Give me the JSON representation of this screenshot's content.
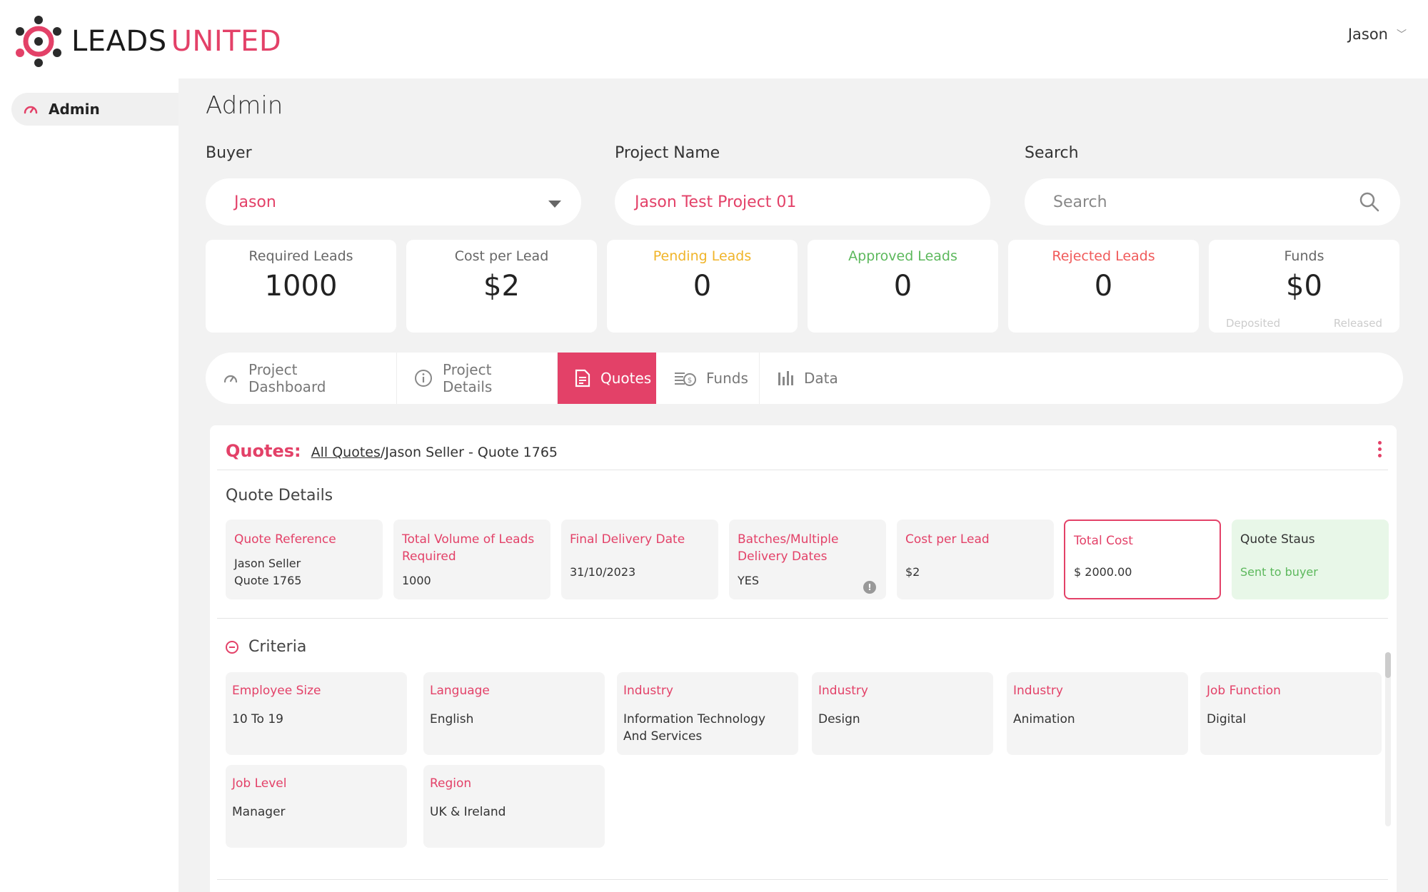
{
  "header": {
    "logo_part1": "LEADS",
    "logo_part2": "UNITED",
    "user_name": "Jason"
  },
  "sidebar": {
    "items": [
      {
        "label": "Admin",
        "icon": "gauge-icon"
      }
    ]
  },
  "page": {
    "title": "Admin"
  },
  "filters": {
    "buyer_label": "Buyer",
    "buyer_value": "Jason",
    "project_label": "Project Name",
    "project_value": "Jason Test Project 01",
    "search_label": "Search",
    "search_placeholder": "Search"
  },
  "stats": [
    {
      "label": "Required Leads",
      "value": "1000",
      "color": "#666666"
    },
    {
      "label": "Cost per Lead",
      "value": "$2",
      "color": "#666666"
    },
    {
      "label": "Pending Leads",
      "value": "0",
      "color": "#f0b429"
    },
    {
      "label": "Approved Leads",
      "value": "0",
      "color": "#5cb85c"
    },
    {
      "label": "Rejected Leads",
      "value": "0",
      "color": "#f05a5a"
    },
    {
      "label": "Funds",
      "value": "$0",
      "color": "#666666",
      "sub_left": "Deposited",
      "sub_right": "Released"
    }
  ],
  "tabs": [
    {
      "label": "Project Dashboard",
      "icon": "gauge-icon"
    },
    {
      "label": "Project Details",
      "icon": "info-icon"
    },
    {
      "label": "Quotes",
      "icon": "document-icon",
      "active": true
    },
    {
      "label": "Funds",
      "icon": "money-icon"
    },
    {
      "label": "Data",
      "icon": "bar-chart-icon"
    }
  ],
  "quotes": {
    "heading": "Quotes:",
    "breadcrumb_link": "All Quotes",
    "breadcrumb_current": "/Jason Seller - Quote 1765",
    "section_title": "Quote Details",
    "details": [
      {
        "label": "Quote Reference",
        "value": "Jason Seller\nQuote 1765"
      },
      {
        "label": "Total Volume of Leads Required",
        "value": "1000"
      },
      {
        "label": "Final Delivery Date",
        "value": "31/10/2023"
      },
      {
        "label": "Batches/Multiple Delivery Dates",
        "value": "YES"
      },
      {
        "label": "Cost per Lead",
        "value": "$2"
      },
      {
        "label": "Total Cost",
        "value": "$ 2000.00"
      },
      {
        "label": "Quote Staus",
        "value": "Sent to buyer"
      }
    ],
    "criteria_title": "Criteria",
    "criteria": [
      {
        "label": "Employee Size",
        "value": "10 To 19"
      },
      {
        "label": "Language",
        "value": "English"
      },
      {
        "label": "Industry",
        "value": "Information Technology And Services"
      },
      {
        "label": "Industry",
        "value": "Design"
      },
      {
        "label": "Industry",
        "value": "Animation"
      },
      {
        "label": "Job Function",
        "value": "Digital"
      },
      {
        "label": "Job Level",
        "value": "Manager"
      },
      {
        "label": "Region",
        "value": "UK & Ireland"
      }
    ]
  },
  "colors": {
    "accent": "#e34168",
    "success": "#5cb85c"
  }
}
